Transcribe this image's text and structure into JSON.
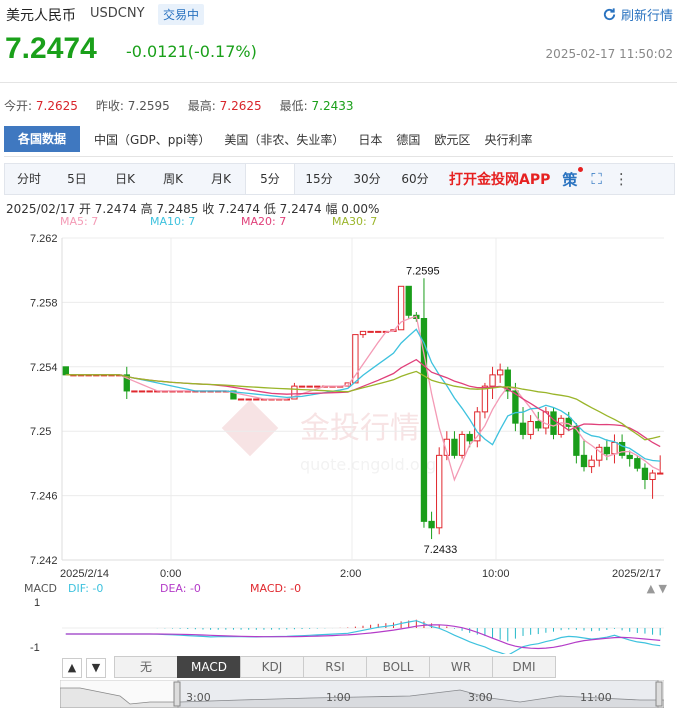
{
  "header": {
    "title": "美元人民币",
    "code": "USDCNY",
    "status": "交易中",
    "refresh_label": "刷新行情",
    "price": "7.2474",
    "change": "-0.0121(-0.17%)",
    "timestamp": "2025-02-17 11:50:02"
  },
  "stats": {
    "open_label": "今开:",
    "open_value": "7.2625",
    "prev_label": "昨收:",
    "prev_value": "7.2595",
    "high_label": "最高:",
    "high_value": "7.2625",
    "low_label": "最低:",
    "low_value": "7.2433"
  },
  "nav": {
    "items": [
      "各国数据",
      "中国（GDP、ppi等）",
      "美国（非农、失业率）",
      "日本",
      "德国",
      "欧元区",
      "央行利率"
    ]
  },
  "tabs": {
    "items": [
      "分时",
      "5日",
      "日K",
      "周K",
      "月K",
      "5分",
      "15分",
      "30分",
      "60分"
    ],
    "active": "5分",
    "app_label": "打开金投网APP",
    "app_icon": "策"
  },
  "ohlc_line": "2025/02/17  开 7.2474  高 7.2485  收 7.2474  低 7.2474  幅 0.00%",
  "ma_labels": {
    "ma5": "MA5: 7",
    "ma10": "MA10: 7",
    "ma20": "MA20: 7",
    "ma30": "MA30: 7"
  },
  "colors": {
    "up": "#e0282e",
    "down": "#1a9d1a",
    "ma5": "#f49ab5",
    "ma10": "#3ec2de",
    "ma20": "#e0407a",
    "ma30": "#9ab52a",
    "accent": "#2a73c0"
  },
  "watermark": {
    "text": "金投行情",
    "sub": "quote.cngold.org"
  },
  "chart_data": {
    "type": "candlestick",
    "yticks": [
      "7.262",
      "7.258",
      "7.254",
      "7.25",
      "7.246",
      "7.242"
    ],
    "ylim": [
      7.242,
      7.262
    ],
    "xticks": [
      "2025/2/14",
      "0:00",
      "2:00",
      "10:00",
      "2025/2/17"
    ],
    "high_annotation": "7.2595",
    "low_annotation": "7.2433",
    "candles": [
      [
        7.254,
        7.254,
        7.2535,
        7.2535
      ],
      [
        7.2535,
        7.2535,
        7.2535,
        7.2535
      ],
      [
        7.2535,
        7.2535,
        7.2535,
        7.2535
      ],
      [
        7.2535,
        7.2535,
        7.2535,
        7.2535
      ],
      [
        7.2535,
        7.2535,
        7.2535,
        7.2535
      ],
      [
        7.2535,
        7.2535,
        7.2535,
        7.2535
      ],
      [
        7.2535,
        7.2535,
        7.2535,
        7.2535
      ],
      [
        7.2535,
        7.2535,
        7.2535,
        7.2535
      ],
      [
        7.2535,
        7.254,
        7.252,
        7.2525
      ],
      [
        7.2525,
        7.2525,
        7.2525,
        7.2525
      ],
      [
        7.2525,
        7.2525,
        7.2525,
        7.2525
      ],
      [
        7.2525,
        7.2525,
        7.2525,
        7.2525
      ],
      [
        7.2525,
        7.2525,
        7.2525,
        7.2525
      ],
      [
        7.2525,
        7.2525,
        7.2525,
        7.2525
      ],
      [
        7.2525,
        7.2525,
        7.2525,
        7.2525
      ],
      [
        7.2525,
        7.2525,
        7.2525,
        7.2525
      ],
      [
        7.2525,
        7.2525,
        7.2525,
        7.2525
      ],
      [
        7.2525,
        7.2525,
        7.2525,
        7.2525
      ],
      [
        7.2525,
        7.2525,
        7.2525,
        7.2525
      ],
      [
        7.2525,
        7.2525,
        7.2525,
        7.2525
      ],
      [
        7.2525,
        7.2525,
        7.2525,
        7.2525
      ],
      [
        7.2525,
        7.2525,
        7.2525,
        7.2525
      ],
      [
        7.2525,
        7.2525,
        7.252,
        7.252
      ],
      [
        7.252,
        7.252,
        7.252,
        7.252
      ],
      [
        7.252,
        7.252,
        7.252,
        7.252
      ],
      [
        7.252,
        7.252,
        7.252,
        7.252
      ],
      [
        7.252,
        7.252,
        7.252,
        7.252
      ],
      [
        7.252,
        7.252,
        7.252,
        7.252
      ],
      [
        7.252,
        7.252,
        7.252,
        7.252
      ],
      [
        7.252,
        7.252,
        7.252,
        7.252
      ],
      [
        7.252,
        7.253,
        7.252,
        7.2528
      ],
      [
        7.2528,
        7.2528,
        7.2528,
        7.2528
      ],
      [
        7.2528,
        7.2528,
        7.2528,
        7.2528
      ],
      [
        7.2528,
        7.2528,
        7.2528,
        7.2528
      ],
      [
        7.2528,
        7.2528,
        7.2528,
        7.2528
      ],
      [
        7.2528,
        7.2528,
        7.2528,
        7.2528
      ],
      [
        7.2528,
        7.2528,
        7.2528,
        7.2528
      ],
      [
        7.2528,
        7.253,
        7.2528,
        7.253
      ],
      [
        7.253,
        7.256,
        7.253,
        7.256
      ],
      [
        7.256,
        7.2562,
        7.2558,
        7.2562
      ],
      [
        7.2562,
        7.2562,
        7.2562,
        7.2562
      ],
      [
        7.2562,
        7.2562,
        7.2562,
        7.2562
      ],
      [
        7.2562,
        7.2562,
        7.2562,
        7.2562
      ],
      [
        7.2562,
        7.2563,
        7.2562,
        7.2563
      ],
      [
        7.2563,
        7.259,
        7.2563,
        7.259
      ],
      [
        7.259,
        7.259,
        7.257,
        7.2572
      ],
      [
        7.2572,
        7.2574,
        7.2568,
        7.257
      ],
      [
        7.257,
        7.2595,
        7.244,
        7.2444
      ],
      [
        7.2444,
        7.245,
        7.2433,
        7.244
      ],
      [
        7.244,
        7.249,
        7.2436,
        7.2485
      ],
      [
        7.2485,
        7.25,
        7.2482,
        7.2495
      ],
      [
        7.2495,
        7.25,
        7.2483,
        7.2485
      ],
      [
        7.2485,
        7.25,
        7.2483,
        7.2498
      ],
      [
        7.2498,
        7.25,
        7.249,
        7.2494
      ],
      [
        7.2494,
        7.2515,
        7.249,
        7.2512
      ],
      [
        7.2512,
        7.253,
        7.2508,
        7.2528
      ],
      [
        7.2528,
        7.254,
        7.252,
        7.2535
      ],
      [
        7.2535,
        7.2542,
        7.253,
        7.2538
      ],
      [
        7.2538,
        7.254,
        7.252,
        7.2525
      ],
      [
        7.2525,
        7.253,
        7.25,
        7.2505
      ],
      [
        7.2505,
        7.2515,
        7.2495,
        7.2498
      ],
      [
        7.2498,
        7.251,
        7.2495,
        7.2506
      ],
      [
        7.2506,
        7.2512,
        7.25,
        7.2502
      ],
      [
        7.2502,
        7.2515,
        7.2498,
        7.2512
      ],
      [
        7.2512,
        7.2515,
        7.2495,
        7.2498
      ],
      [
        7.2498,
        7.251,
        7.2496,
        7.2508
      ],
      [
        7.2508,
        7.2512,
        7.25,
        7.2503
      ],
      [
        7.2503,
        7.2505,
        7.248,
        7.2485
      ],
      [
        7.2485,
        7.2495,
        7.2475,
        7.2478
      ],
      [
        7.2478,
        7.2485,
        7.2474,
        7.2482
      ],
      [
        7.2482,
        7.2492,
        7.2478,
        7.249
      ],
      [
        7.249,
        7.2495,
        7.2482,
        7.2486
      ],
      [
        7.2486,
        7.2498,
        7.248,
        7.2493
      ],
      [
        7.2493,
        7.2498,
        7.2483,
        7.2485
      ],
      [
        7.2485,
        7.2488,
        7.2478,
        7.2483
      ],
      [
        7.2483,
        7.2485,
        7.2475,
        7.2477
      ],
      [
        7.2477,
        7.248,
        7.2464,
        7.247
      ],
      [
        7.247,
        7.2476,
        7.2458,
        7.2474
      ],
      [
        7.2474,
        7.2485,
        7.2474,
        7.2474
      ]
    ]
  },
  "macd": {
    "label": "MACD",
    "dif": "DIF: -0",
    "dea": "DEA: -0",
    "macd": "MACD: -0",
    "ytop": "1",
    "ybottom": "-1"
  },
  "bottom_tabs": [
    "无",
    "MACD",
    "KDJ",
    "RSI",
    "BOLL",
    "WR",
    "DMI"
  ],
  "bottom_active": "MACD",
  "navigator_labels": [
    "3:00",
    "1:00",
    "3:00",
    "11:00"
  ]
}
